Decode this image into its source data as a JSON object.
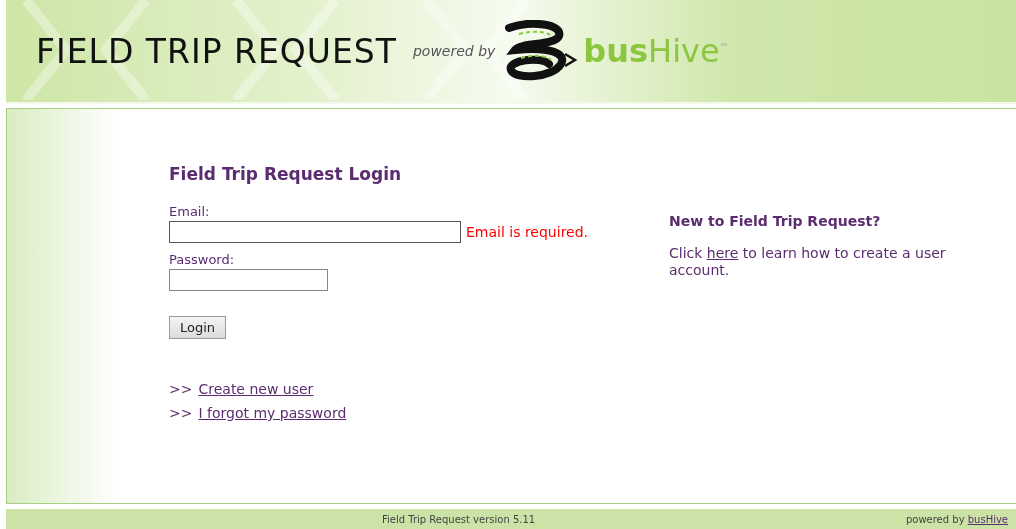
{
  "header": {
    "title": "FIELD TRIP REQUEST",
    "powered_by": "powered by",
    "brand": "**bus**Hive$^{™}$"
  },
  "login": {
    "heading": "Field Trip Request Login",
    "fields": [
      {
        "label": "Email:",
        "kind": "email",
        "error": "Email is required."
      },
      {
        "label": "Password:",
        "kind": "password"
      }
    ],
    "button": "Login",
    "links": [
      {
        "prefix": ">>",
        "label": "Create new user"
      },
      {
        "prefix": ">>",
        "label": "I forgot my password"
      }
    ]
  },
  "info": {
    "heading": "New to Field Trip Request?",
    "before": "Click ",
    "link": "here",
    "after": " to learn how to create a user account."
  },
  "footer": {
    "version": "Field Trip Request version 5.11",
    "powered_before": "powered by ",
    "powered_link": "busHive"
  }
}
